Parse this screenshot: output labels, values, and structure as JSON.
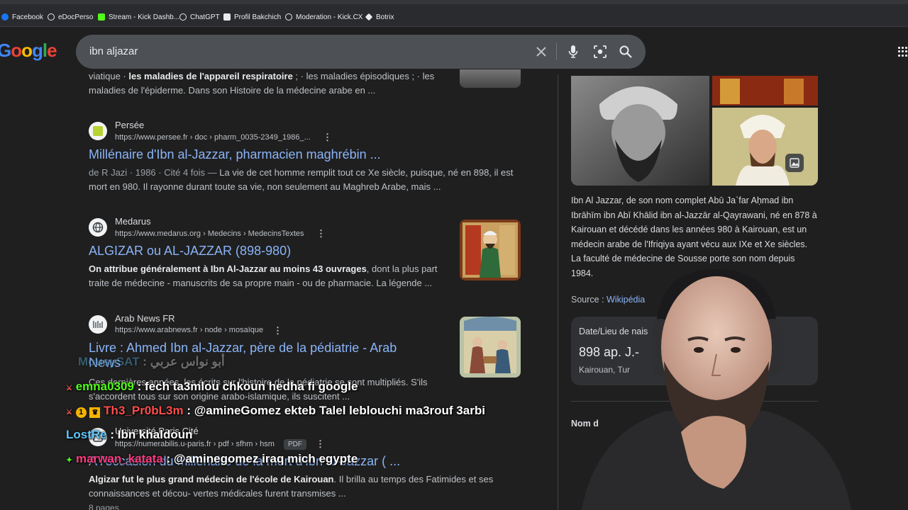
{
  "bookmarks": [
    {
      "label": "Facebook",
      "icon": "facebook-icon",
      "color": "#1877f2"
    },
    {
      "label": "eDocPerso",
      "icon": "edocperso-icon",
      "color": "#e8eaed"
    },
    {
      "label": "Stream - Kick Dashb...",
      "icon": "kick-icon",
      "color": "#53fc18"
    },
    {
      "label": "ChatGPT",
      "icon": "chatgpt-icon",
      "color": "#e8eaed"
    },
    {
      "label": "Profil Bakchich",
      "icon": "bakchich-icon",
      "color": "#4285f4"
    },
    {
      "label": "Moderation - Kick.CX",
      "icon": "moderation-icon",
      "color": "#e8eaed"
    },
    {
      "label": "Botrix",
      "icon": "botrix-icon",
      "color": "#e8eaed"
    }
  ],
  "logo": {
    "text": "oogle"
  },
  "search": {
    "query": "ibn aljazar"
  },
  "results": {
    "top_snippet": {
      "line1_bold": "les maladies de l'appareil respiratoire",
      "line1_pre": "viatique · ",
      "line1_post": " ; · les maladies épisodiques ; ·  les",
      "line2": "maladies de l'épiderme. Dans son Histoire de la médecine arabe en ..."
    },
    "items": [
      {
        "site": "Persée",
        "url": "https://www.persee.fr › doc › pharm_0035-2349_1986_...",
        "title": "Millénaire d'Ibn al-Jazzar, pharmacien maghrébin ...",
        "meta": "de R Jazi · 1986 · Cité 4 fois — ",
        "line1": "La vie de cet homme remplit tout ce Xe siècle, puisque, né en 898, il est",
        "line2": "mort en 980. Il rayonne durant toute sa vie, non seulement au Maghreb Arabe, mais ..."
      },
      {
        "site": "Medarus",
        "url": "https://www.medarus.org › Medecins › MedecinsTextes",
        "title": "ALGIZAR ou AL-JAZZAR (898-980)",
        "bold": "On attribue généralement à Ibn Al-Jazzar au moins 43 ouvrages",
        "line1_post": ", dont la plus part",
        "line2": "traite de médecine - manuscrits de sa propre main - ou de pharmacie. La légende ..."
      },
      {
        "site": "Arab News FR",
        "url": "https://www.arabnews.fr › node › mosaïque",
        "title_line1": "Livre : Ahmed Ibn al-Jazzar, père de la pédiatrie - Arab",
        "title_line2": "News",
        "line1": "Ces dernières années, les écrits sur l'histoire de la pédiatrie se sont multipliés. S'ils",
        "line2": "s'accordent tous sur son origine arabo-islamique, ils suscitent ..."
      },
      {
        "site": "Université Paris Cité",
        "url": "https://numerabilis.u-paris.fr › pdf › sfhm › hsm",
        "badge": "PDF",
        "title": "A l'occasion du millénaire de la mort d'Ibn al-Jazzar ( ...",
        "bold": "Algizar fut le plus grand médecin de l'école de Kairouan",
        "line1_post": ". Il brilla au temps des Fatimides et ses",
        "line2": "connaissances et décou- vertes médicales furent transmises ...",
        "line3": "8 pages"
      }
    ]
  },
  "knowledge_panel": {
    "description": "Ibn Al Jazzar, de son nom complet Abū Ja`far Aḥmad ibn Ibrāhīm ibn Abī Khālid ibn al-Jazzār al-Qayrawani, né en 878 à Kairouan et décédé dans les années 980 à Kairouan, est un médecin arabe de l'Ifriqiya ayant vécu aux IXe et Xe siècles. La faculté de médecine de Sousse porte son nom depuis 1984.",
    "source_label": "Source : ",
    "source_link": "Wikipédia",
    "card_label": "Date/Lieu de nais",
    "card_value": "898 ap. J.-",
    "card_place": "Kairouan, Tur",
    "nom_label": "Nom d"
  },
  "chat": [
    {
      "user": "MousySAT",
      "message": " : أبو نواس عربي",
      "user_color": "#5ec8ff",
      "faded": true
    },
    {
      "user": "emna0309",
      "message": " : fech ta3mlou chkoun hedha fi google",
      "user_color": "#53fc18",
      "faded": false
    },
    {
      "user": "Th3_Pr0bL3m",
      "message": " : @amineGomez ekteb Talel leblouchi ma3rouf 3arbi",
      "user_color": "#ff4d4d",
      "faded": false
    },
    {
      "user": "LostRe",
      "message": " : Ibn khaldoun",
      "user_color": "#5ec8ff",
      "faded": false
    },
    {
      "user": "marwan_katata",
      "message": " : @aminegomez iraq mich egypte",
      "user_color": "#ff3b7f",
      "faded": false
    }
  ],
  "colors": {
    "link": "#8ab4f8",
    "background": "#1f1f1f",
    "searchbox": "#4d5156"
  }
}
